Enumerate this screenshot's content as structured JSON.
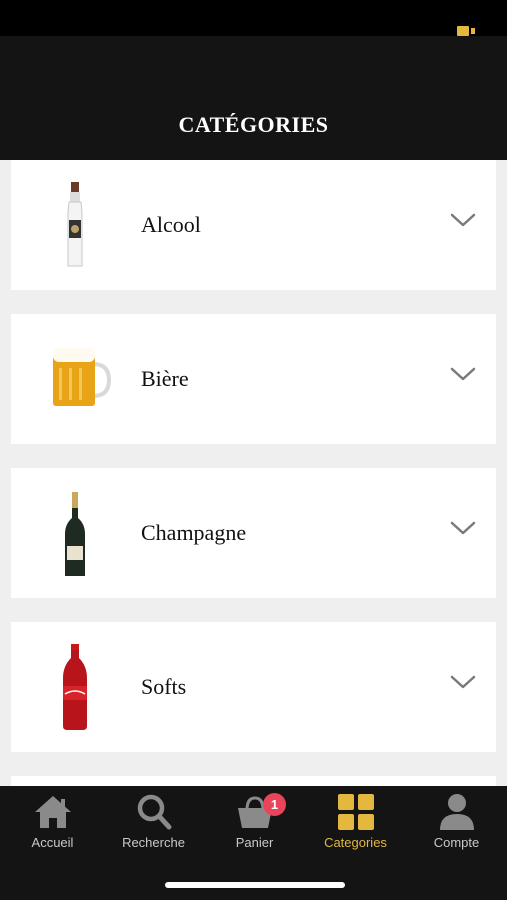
{
  "header": {
    "title": "CATÉGORIES"
  },
  "categories": [
    {
      "label": "Alcool",
      "icon": "vodka-bottle-icon"
    },
    {
      "label": "Bière",
      "icon": "beer-mug-icon"
    },
    {
      "label": "Champagne",
      "icon": "champagne-bottle-icon"
    },
    {
      "label": "Softs",
      "icon": "soda-bottle-icon"
    }
  ],
  "tabbar": {
    "tabs": [
      {
        "label": "Accueil",
        "icon": "home-icon"
      },
      {
        "label": "Recherche",
        "icon": "search-icon"
      },
      {
        "label": "Panier",
        "icon": "basket-icon",
        "badge": "1"
      },
      {
        "label": "Categories",
        "icon": "grid-icon",
        "active": true
      },
      {
        "label": "Compte",
        "icon": "user-icon"
      }
    ]
  },
  "colors": {
    "accent": "#e4b73f",
    "badge": "#e8455c",
    "header_bg": "#141414",
    "page_bg": "#efefef"
  }
}
